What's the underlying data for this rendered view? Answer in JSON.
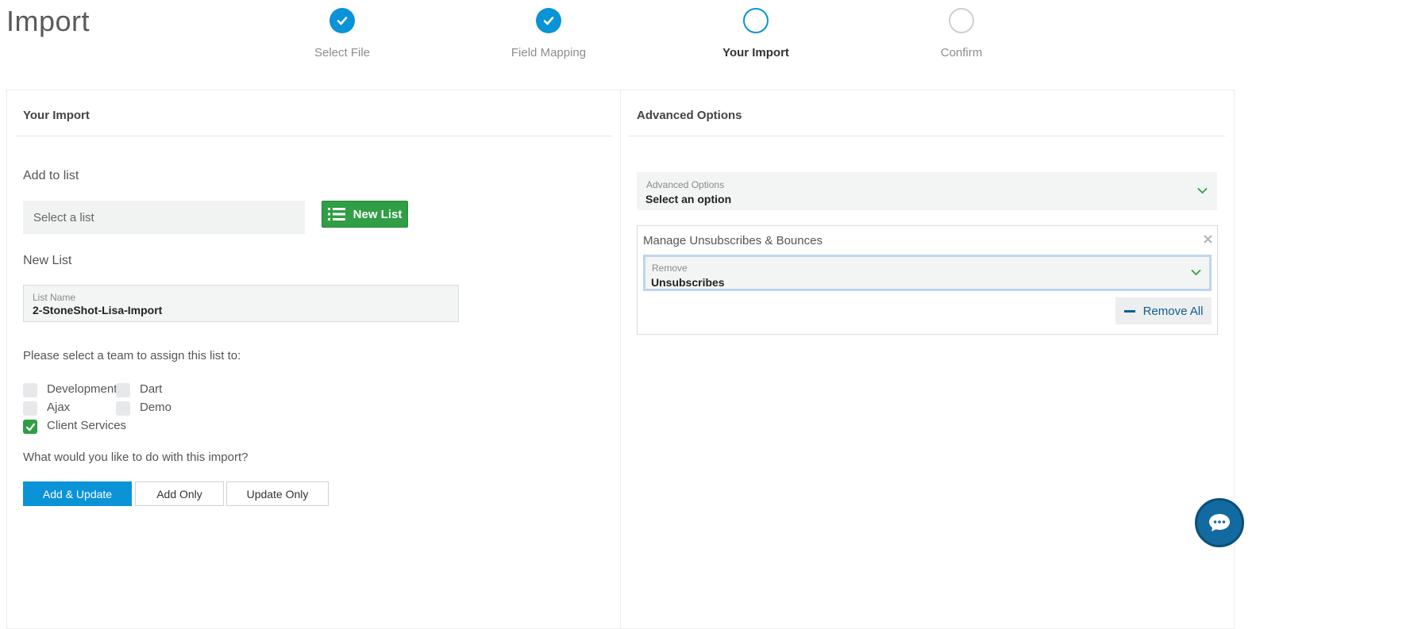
{
  "page": {
    "title": "Import"
  },
  "steps": [
    {
      "label": "Select File",
      "state": "done"
    },
    {
      "label": "Field Mapping",
      "state": "done"
    },
    {
      "label": "Your Import",
      "state": "active"
    },
    {
      "label": "Confirm",
      "state": "todo"
    }
  ],
  "left_panel": {
    "heading": "Your Import",
    "add_to_list_label": "Add to list",
    "select_list_placeholder": "Select a list",
    "new_list_button": "New List",
    "new_list_section_label": "New List",
    "list_name_label": "List Name",
    "list_name_value": "2-StoneShot-Lisa-Import",
    "team_prompt": "Please select a team to assign this list to:",
    "teams": [
      {
        "label": "Development",
        "checked": false
      },
      {
        "label": "Dart",
        "checked": false
      },
      {
        "label": "Ajax",
        "checked": false
      },
      {
        "label": "Demo",
        "checked": false
      },
      {
        "label": "Client Services",
        "checked": true
      }
    ],
    "import_prompt": "What would you like to do with this import?",
    "actions": {
      "add_update": "Add & Update",
      "add_only": "Add Only",
      "update_only": "Update Only",
      "selected": "Add & Update"
    }
  },
  "right_panel": {
    "heading": "Advanced Options",
    "advanced_select": {
      "label": "Advanced Options",
      "value": "Select an option"
    },
    "manage_box": {
      "title": "Manage Unsubscribes & Bounces",
      "remove_select": {
        "label": "Remove",
        "value": "Unsubscribes"
      },
      "remove_all_button": "Remove All"
    }
  },
  "colors": {
    "primary": "#0a93d6",
    "success": "#2f9e44",
    "focus_border": "#bcd6ef",
    "chat": "#136aa1"
  },
  "icons": {
    "step_done": "check-icon",
    "new_list": "list-icon",
    "chevron": "chevron-down-icon",
    "close": "close-icon",
    "minus": "minus-icon",
    "chat": "chat-bubble-icon"
  }
}
